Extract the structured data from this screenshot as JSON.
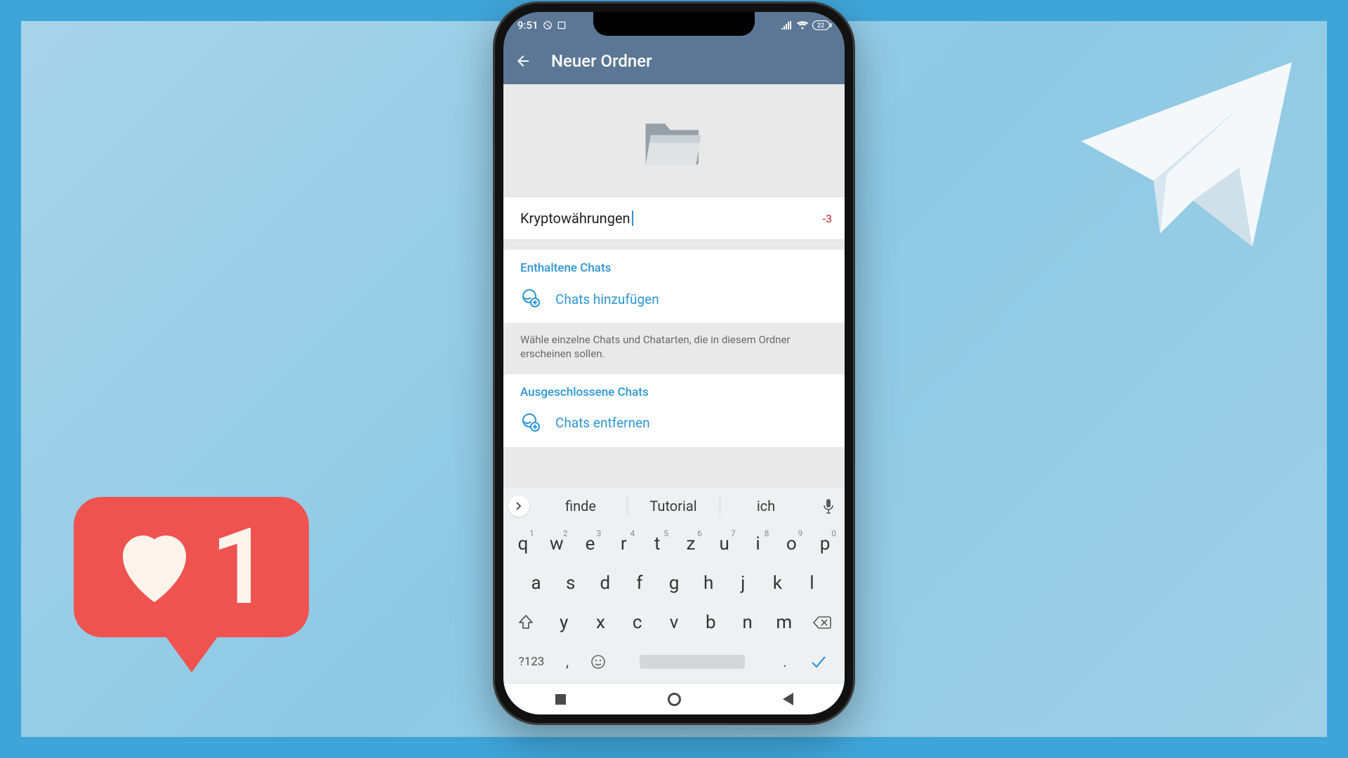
{
  "background": {
    "like_count": "1"
  },
  "statusbar": {
    "time": "9:51",
    "battery": "22"
  },
  "appbar": {
    "title": "Neuer Ordner"
  },
  "folder_name": {
    "value": "Kryptowährungen",
    "counter": "-3"
  },
  "included": {
    "title": "Enthaltene Chats",
    "action": "Chats hinzufügen",
    "desc": "Wähle einzelne Chats und Chatarten, die in diesem Ordner erscheinen sollen."
  },
  "excluded": {
    "title": "Ausgeschlossene Chats",
    "action": "Chats entfernen"
  },
  "keyboard": {
    "suggestions": [
      "finde",
      "Tutorial",
      "ich"
    ],
    "row1": [
      {
        "k": "q",
        "n": "1"
      },
      {
        "k": "w",
        "n": "2"
      },
      {
        "k": "e",
        "n": "3"
      },
      {
        "k": "r",
        "n": "4"
      },
      {
        "k": "t",
        "n": "5"
      },
      {
        "k": "z",
        "n": "6"
      },
      {
        "k": "u",
        "n": "7"
      },
      {
        "k": "i",
        "n": "8"
      },
      {
        "k": "o",
        "n": "9"
      },
      {
        "k": "p",
        "n": "0"
      }
    ],
    "row2": [
      "a",
      "s",
      "d",
      "f",
      "g",
      "h",
      "j",
      "k",
      "l"
    ],
    "row3": [
      "y",
      "x",
      "c",
      "v",
      "b",
      "n",
      "m"
    ],
    "sym": "?123",
    "comma": ",",
    "dot": "."
  }
}
